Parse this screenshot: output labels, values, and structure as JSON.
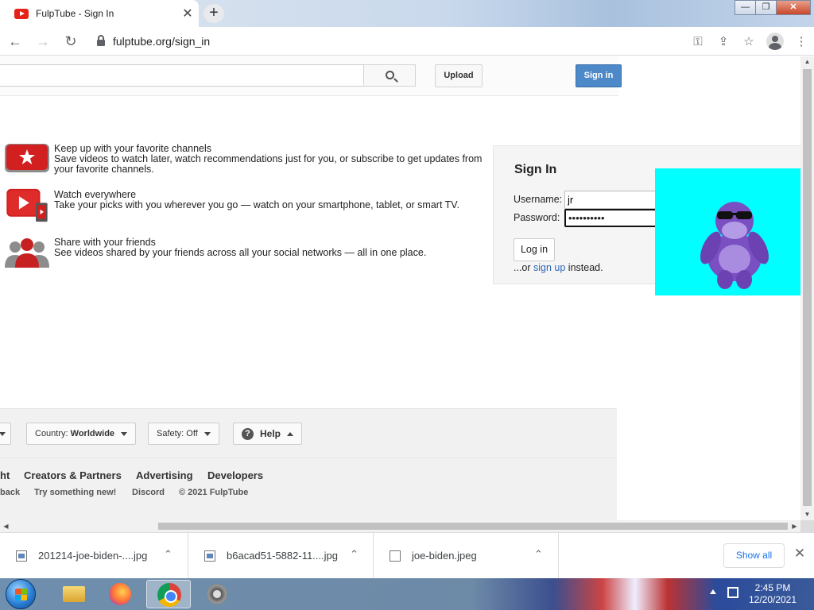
{
  "browser": {
    "tab_title": "FulpTube - Sign In",
    "tab_close": "✕",
    "new_tab": "+",
    "url": "fulptube.org/sign_in",
    "back": "←",
    "forward": "→",
    "reload": "↻",
    "key_icon": "⚿",
    "share_icon": "⇪",
    "star_icon": "☆",
    "menu_icon": "⋮",
    "window_controls": {
      "minimize": "—",
      "maximize": "❐",
      "close": "✕"
    }
  },
  "masthead": {
    "upload_label": "Upload",
    "signin_label": "Sign in"
  },
  "features": [
    {
      "title": "Keep up with your favorite channels",
      "desc": "Save videos to watch later, watch recommendations just for you, or subscribe to get updates from your favorite channels."
    },
    {
      "title": "Watch everywhere",
      "desc": "Take your picks with you wherever you go — watch on your smartphone, tablet, or smart TV."
    },
    {
      "title": "Share with your friends",
      "desc": "See videos shared by your friends across all your social networks — all in one place."
    }
  ],
  "signin": {
    "heading": "Sign In",
    "username_label": "Username:",
    "username_value": "jr",
    "password_label": "Password:",
    "password_value": "••••••••••",
    "login_label": "Log in",
    "or_text": "...or ",
    "signup_link": "sign up",
    "instead_text": " instead."
  },
  "footer": {
    "country_prefix": "Country: ",
    "country_value": "Worldwide",
    "safety_prefix": "Safety: ",
    "safety_value": "Off",
    "help_label": "Help",
    "help_icon": "?",
    "links": [
      "ht",
      "Creators & Partners",
      "Advertising",
      "Developers"
    ],
    "small_links": [
      "back",
      "Try something new!",
      "Discord",
      "© 2021 FulpTube"
    ]
  },
  "downloads": {
    "items": [
      {
        "name": "201214-joe-biden-....jpg"
      },
      {
        "name": "b6acad51-5882-11....jpg"
      },
      {
        "name": "joe-biden.jpeg"
      }
    ],
    "chevron": "⌃",
    "show_all": "Show all",
    "close": "✕"
  },
  "taskbar": {
    "time": "2:45 PM",
    "date": "12/20/2021"
  },
  "colors": {
    "brand_red": "#e62117",
    "signin_blue": "#4d88c8",
    "overlay_cyan": "#00ffff",
    "link_blue": "#2a66b8"
  }
}
